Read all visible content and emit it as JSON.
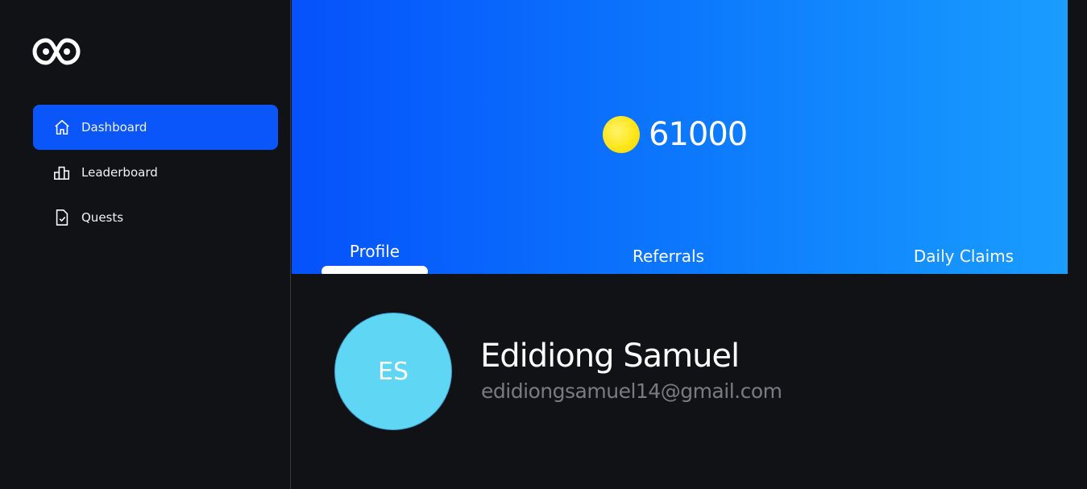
{
  "sidebar": {
    "logo_icon": "infinity-logo-icon",
    "items": [
      {
        "label": "Dashboard",
        "icon": "home-icon",
        "active": true
      },
      {
        "label": "Leaderboard",
        "icon": "bar-chart-icon",
        "active": false
      },
      {
        "label": "Quests",
        "icon": "checklist-document-icon",
        "active": false
      }
    ]
  },
  "banner": {
    "coin_icon": "coin-icon",
    "balance": "61000",
    "gradient_colors": [
      "#0552fb",
      "#199dfe"
    ]
  },
  "tabs": [
    {
      "label": "Profile",
      "active": true
    },
    {
      "label": "Referrals",
      "active": false
    },
    {
      "label": "Daily Claims",
      "active": false
    }
  ],
  "profile": {
    "initials": "ES",
    "name": "Edidiong Samuel",
    "email": "edidiongsamuel14@gmail.com",
    "avatar_color": "#5fd6f4"
  },
  "colors": {
    "accent": "#0a56fb",
    "background": "#111216"
  }
}
